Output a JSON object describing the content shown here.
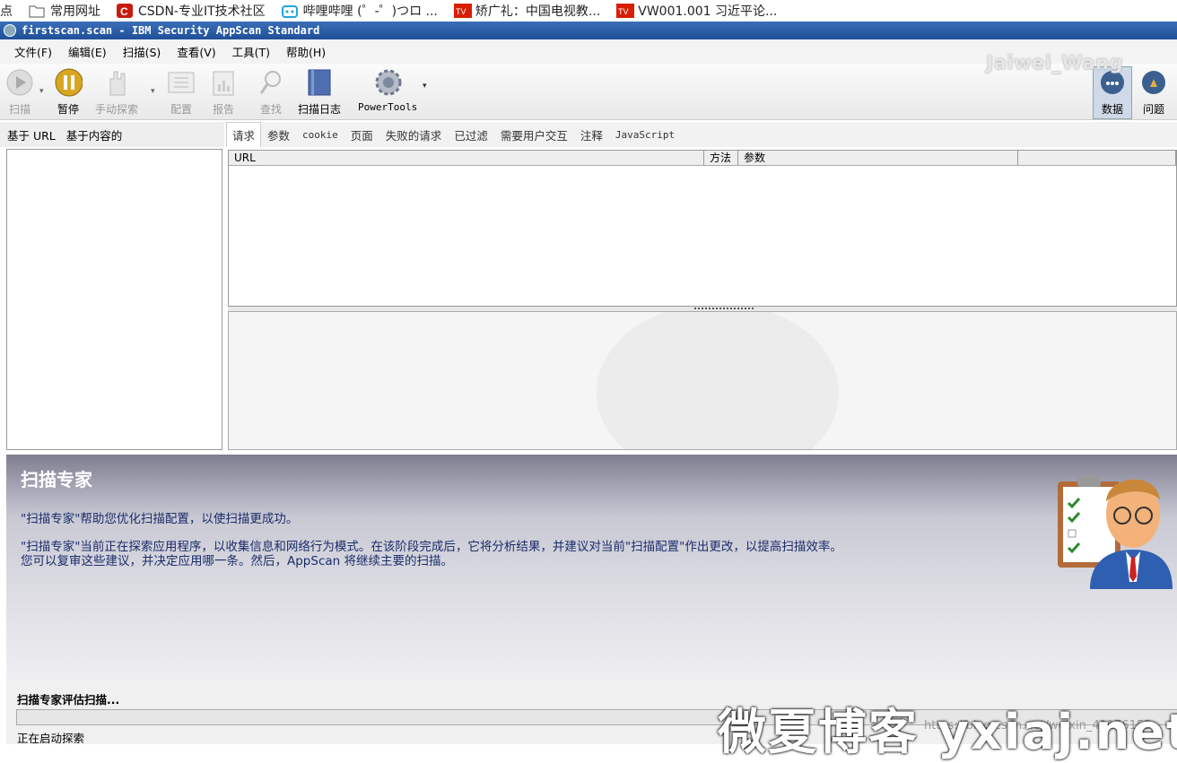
{
  "bookmarks": [
    {
      "icon": "folder-icon",
      "label": "点"
    },
    {
      "icon": "folder-icon",
      "label": "常用网址"
    },
    {
      "icon": "csdn-icon",
      "label": "CSDN-专业IT技术社区"
    },
    {
      "icon": "bilibili-icon",
      "label": "哔哩哔哩 (゜-゜)つロ ..."
    },
    {
      "icon": "cntv-icon",
      "label": "矫广礼：中国电视教..."
    },
    {
      "icon": "cntv-icon",
      "label": "VW001.001 习近平论..."
    }
  ],
  "window": {
    "title": "firstscan.scan - IBM Security AppScan Standard"
  },
  "menu": [
    "文件(F)",
    "编辑(E)",
    "扫描(S)",
    "查看(V)",
    "工具(T)",
    "帮助(H)"
  ],
  "toolbar": {
    "scan": "扫描",
    "pause": "暂停",
    "manual": "手动探索",
    "config": "配置",
    "report": "报告",
    "find": "查找",
    "log": "扫描日志",
    "powertools": "PowerTools",
    "data": "数据",
    "issues": "问题"
  },
  "watermark_top": "Jaiwei_Wang",
  "left_tabs": [
    "基于 URL",
    "基于内容的"
  ],
  "right_tabs": [
    "请求",
    "参数",
    "cookie",
    "页面",
    "失败的请求",
    "已过滤",
    "需要用户交互",
    "注释",
    "JavaScript"
  ],
  "grid": {
    "columns": [
      "URL",
      "方法",
      "参数"
    ]
  },
  "expert": {
    "title": "扫描专家",
    "p1": "\"扫描专家\"帮助您优化扫描配置，以使扫描更成功。",
    "p2": "\"扫描专家\"当前正在探索应用程序，以收集信息和网络行为模式。在该阶段完成后，它将分析结果，并建议对当前\"扫描配置\"作出更改，以提高扫描效率。",
    "p3": "您可以复审这些建议，并决定应用哪一条。然后，AppScan 将继续主要的扫描。"
  },
  "status": {
    "evaluating": "扫描专家评估扫描...",
    "progress": 0.0,
    "exploring": "正在启动探索"
  },
  "watermark_bottom": "微夏博客 yxiaj.net",
  "watermark_url": "https://blog.csdn.net/weixin_41176153"
}
